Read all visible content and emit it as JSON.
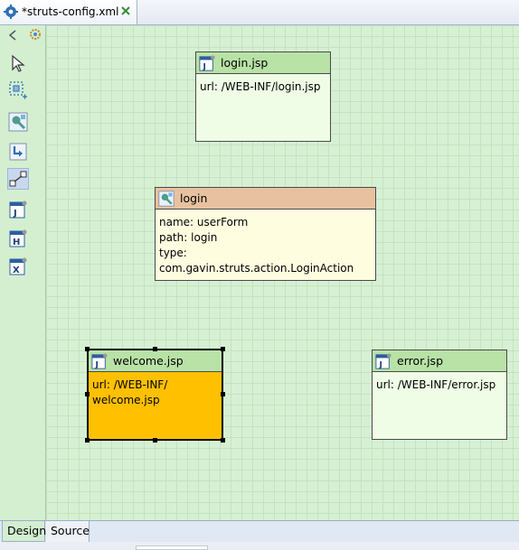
{
  "editor_tab": {
    "title": "*struts-config.xml",
    "icon": "gear-icon",
    "close_icon": "close-icon"
  },
  "palette": {
    "tools": [
      {
        "name": "select-tool",
        "icon": "arrow-pointer-icon"
      },
      {
        "name": "marquee-tool",
        "icon": "marquee-select-icon"
      },
      {
        "name": "action-tool",
        "icon": "action-mapping-icon"
      },
      {
        "name": "forward-tool",
        "icon": "forward-arrow-icon"
      },
      {
        "name": "connection-tool",
        "icon": "connection-icon",
        "selected": true
      },
      {
        "name": "jsp-page-tool",
        "icon": "jsp-page-icon"
      },
      {
        "name": "html-page-tool",
        "icon": "html-page-icon"
      },
      {
        "name": "xml-page-tool",
        "icon": "xml-page-icon"
      }
    ]
  },
  "nodes": {
    "login_jsp": {
      "title": "login.jsp",
      "lines": [
        "url: /WEB-INF/login.jsp"
      ]
    },
    "login_action": {
      "title": "login",
      "lines": [
        "name: userForm",
        "path: login",
        "type: com.gavin.struts.action.LoginAction"
      ]
    },
    "welcome_jsp": {
      "title": "welcome.jsp",
      "lines": [
        "url: /WEB-INF/",
        "welcome.jsp"
      ],
      "selected": true
    },
    "error_jsp": {
      "title": "error.jsp",
      "lines": [
        "url: /WEB-INF/error.jsp"
      ]
    }
  },
  "colors": {
    "canvas": "#d6f0d3",
    "page_header": "#b8e2a6",
    "action_header": "#e8c2a0",
    "selected_fill": "#ffc000"
  },
  "bottom_tabs": [
    {
      "label": "Design",
      "active": true
    },
    {
      "label": "Source",
      "active": false
    }
  ]
}
